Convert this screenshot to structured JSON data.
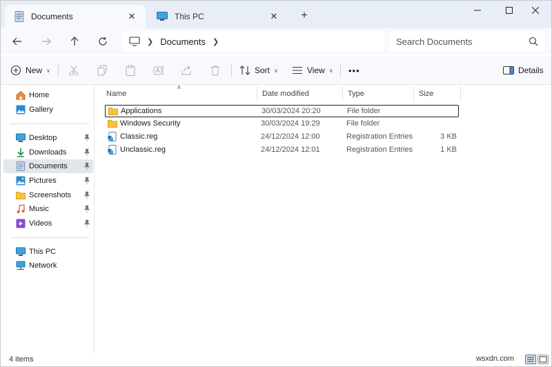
{
  "tabs": [
    {
      "label": "Documents",
      "icon": "documents-icon",
      "active": true
    },
    {
      "label": "This PC",
      "icon": "this-pc-icon",
      "active": false
    }
  ],
  "tab_close_glyph": "✕",
  "new_tab_glyph": "+",
  "address": {
    "breadcrumb": [
      "Documents"
    ]
  },
  "search": {
    "placeholder": "Search Documents"
  },
  "commands": {
    "new_label": "New",
    "sort_label": "Sort",
    "view_label": "View",
    "more_label": "•••",
    "details_label": "Details"
  },
  "sidebar": {
    "top": [
      {
        "label": "Home",
        "icon": "home-icon"
      },
      {
        "label": "Gallery",
        "icon": "gallery-icon"
      }
    ],
    "quick_access": [
      {
        "label": "Desktop",
        "icon": "desktop-icon",
        "pinned": true
      },
      {
        "label": "Downloads",
        "icon": "downloads-icon",
        "pinned": true
      },
      {
        "label": "Documents",
        "icon": "documents-icon",
        "pinned": true,
        "selected": true
      },
      {
        "label": "Pictures",
        "icon": "pictures-icon",
        "pinned": true
      },
      {
        "label": "Screenshots",
        "icon": "folder-icon",
        "pinned": true
      },
      {
        "label": "Music",
        "icon": "music-icon",
        "pinned": true
      },
      {
        "label": "Videos",
        "icon": "videos-icon",
        "pinned": true
      }
    ],
    "devices": [
      {
        "label": "This PC",
        "icon": "this-pc-icon"
      },
      {
        "label": "Network",
        "icon": "network-icon"
      }
    ]
  },
  "columns": {
    "name": "Name",
    "date": "Date modified",
    "type": "Type",
    "size": "Size"
  },
  "files": [
    {
      "name": "Applications",
      "date": "30/03/2024 20:20",
      "type": "File folder",
      "size": "",
      "icon": "folder-icon"
    },
    {
      "name": "Windows Security",
      "date": "30/03/2024 19:29",
      "type": "File folder",
      "size": "",
      "icon": "folder-icon"
    },
    {
      "name": "Classic.reg",
      "date": "24/12/2024 12:00",
      "type": "Registration Entries",
      "size": "3 KB",
      "icon": "registry-file-icon"
    },
    {
      "name": "Unclassic.reg",
      "date": "24/12/2024 12:01",
      "type": "Registration Entries",
      "size": "1 KB",
      "icon": "registry-file-icon"
    }
  ],
  "status": {
    "item_count": "4 items"
  },
  "watermark": "wsxdn.com",
  "colors": {
    "folder": "#f5c242",
    "accent": "#0067c0",
    "selected_bg": "#e3e6ea"
  }
}
